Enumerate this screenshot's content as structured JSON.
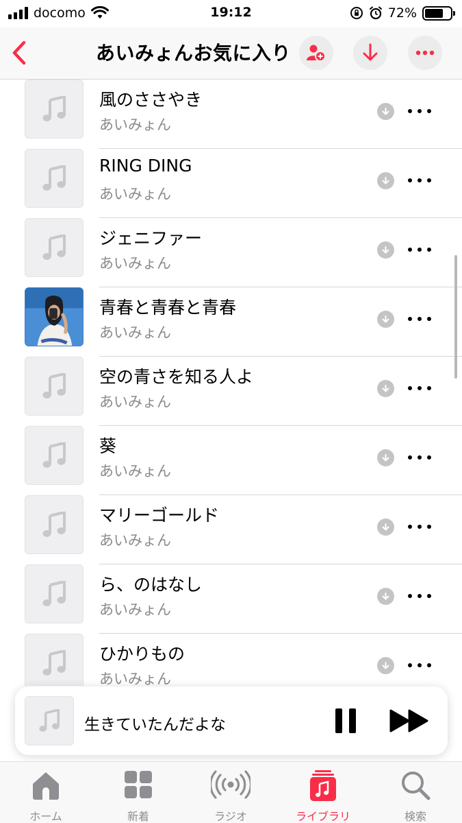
{
  "status_bar": {
    "carrier": "docomo",
    "time": "19:12",
    "battery": "72%",
    "battery_level": 0.72
  },
  "nav": {
    "title": "あいみょんお気に入り",
    "back_icon": "chevron-left-icon",
    "actions": [
      "add-person-icon",
      "download-arrow-icon",
      "ellipsis-icon"
    ]
  },
  "colors": {
    "accent": "#fa2d48",
    "secondary_text": "#8a8a8e",
    "inactive_tab": "#8e8e93"
  },
  "songs": [
    {
      "title": "風のささやき",
      "artist": "あいみょん",
      "artwork": "music-note-placeholder"
    },
    {
      "title": "RING DING",
      "artist": "あいみょん",
      "artwork": "music-note-placeholder"
    },
    {
      "title": "ジェニファー",
      "artist": "あいみょん",
      "artwork": "music-note-placeholder"
    },
    {
      "title": "青春と青春と青春",
      "artist": "あいみょん",
      "artwork": "album-photo"
    },
    {
      "title": "空の青さを知る人よ",
      "artist": "あいみょん",
      "artwork": "music-note-placeholder"
    },
    {
      "title": "葵",
      "artist": "あいみょん",
      "artwork": "music-note-placeholder"
    },
    {
      "title": "マリーゴールド",
      "artist": "あいみょん",
      "artwork": "music-note-placeholder"
    },
    {
      "title": "ら、のはなし",
      "artist": "あいみょん",
      "artwork": "music-note-placeholder"
    },
    {
      "title": "ひかりもの",
      "artist": "あいみょん",
      "artwork": "music-note-placeholder"
    }
  ],
  "mini_player": {
    "title": "生きていたんだよな",
    "state": "playing"
  },
  "tabs": [
    {
      "label": "ホーム",
      "icon": "home-icon",
      "active": false
    },
    {
      "label": "新着",
      "icon": "grid-icon",
      "active": false
    },
    {
      "label": "ラジオ",
      "icon": "radio-icon",
      "active": false
    },
    {
      "label": "ライブラリ",
      "icon": "library-icon",
      "active": true
    },
    {
      "label": "検索",
      "icon": "search-icon",
      "active": false
    }
  ]
}
